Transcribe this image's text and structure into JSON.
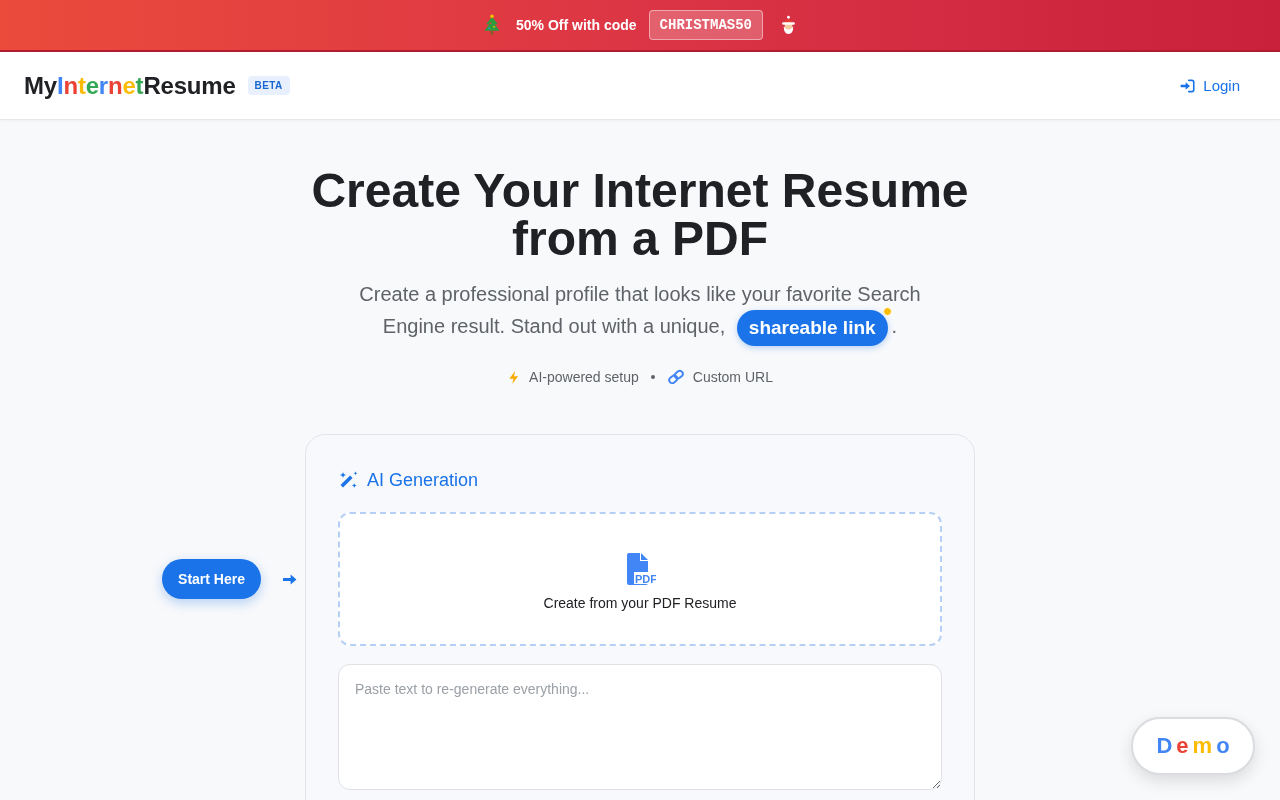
{
  "promo_banner": {
    "text": "50% Off with code",
    "code": "CHRISTMAS50"
  },
  "header": {
    "logo": [
      {
        "text": "My",
        "color": "#202124"
      },
      {
        "text": "I",
        "color": "#4285f4"
      },
      {
        "text": "n",
        "color": "#ea4335"
      },
      {
        "text": "t",
        "color": "#fbbc05"
      },
      {
        "text": "e",
        "color": "#34a853"
      },
      {
        "text": "r",
        "color": "#4285f4"
      },
      {
        "text": "n",
        "color": "#ea4335"
      },
      {
        "text": "e",
        "color": "#fbbc05"
      },
      {
        "text": "t",
        "color": "#34a853"
      },
      {
        "text": "Resume",
        "color": "#202124"
      }
    ],
    "badge": "BETA",
    "login": "Login"
  },
  "hero": {
    "title": "Create Your Internet Resume from a PDF",
    "subtitle": "Create a professional profile that looks like your favorite Search Engine result. Stand out with a unique,",
    "link": "shareable link",
    "subtitle_end": ".",
    "features": [
      {
        "kind": "ai",
        "label": "AI-powered setup"
      },
      {
        "kind": "url",
        "label": "Custom URL"
      }
    ]
  },
  "start_button": "Start Here",
  "card": {
    "title": "AI Generation",
    "upload_label": "Create from your PDF Resume",
    "upload_icon_text": "PDF",
    "textarea_placeholder": "Paste text to re-generate everything..."
  },
  "demo_button": [
    {
      "text": "D",
      "color": "#4285f4"
    },
    {
      "text": "e",
      "color": "#ea4335"
    },
    {
      "text": "m",
      "color": "#fbbc05"
    },
    {
      "text": "o",
      "color": "#4285f4"
    }
  ]
}
